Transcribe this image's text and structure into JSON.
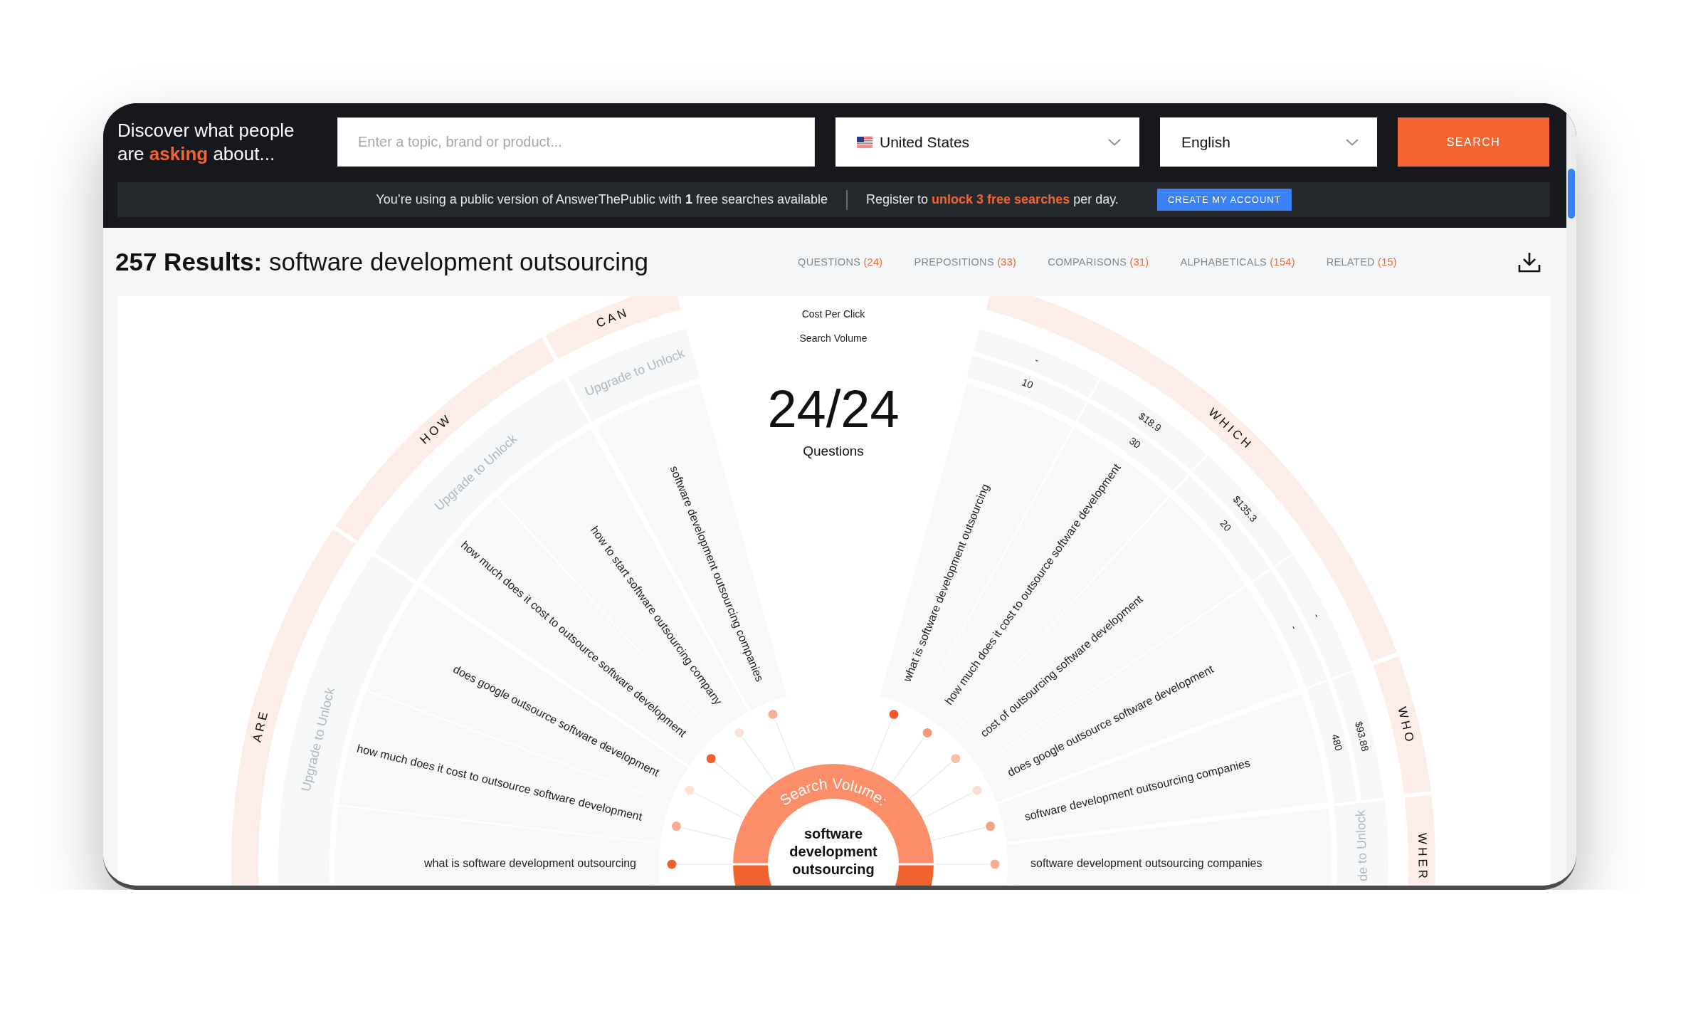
{
  "header": {
    "tagline": "Discover what people are **asking** about...",
    "search_field": {
      "placeholder": "Enter a topic, brand or product..."
    },
    "country": {
      "value": "United States"
    },
    "language": {
      "value": "English"
    },
    "search_button": "SEARCH"
  },
  "notice": {
    "text": "You’re using a public version of AnswerThePublic with **1** free searches available",
    "register_text": "Register to **unlock 3 free searches** per day.",
    "button": "CREATE MY ACCOUNT"
  },
  "results": {
    "title": "**257 Results:** software development outsourcing",
    "tabs": [
      {
        "label": "QUESTIONS",
        "count": "(24)"
      },
      {
        "label": "PREPOSITIONS",
        "count": "(33)"
      },
      {
        "label": "COMPARISONS",
        "count": "(31)"
      },
      {
        "label": "ALPHABETICALS",
        "count": "(154)"
      },
      {
        "label": "RELATED",
        "count": "(15)"
      }
    ]
  },
  "wheel": {
    "legend": [
      "Cost Per Click",
      "Search Volume"
    ],
    "count": "24/24",
    "count_label": "Questions",
    "ring_label": "Search Volume:",
    "center_term": "software development outsourcing",
    "sections": [
      {
        "label": "ARE",
        "locked": true,
        "upgrade_text": "Upgrade to Unlock",
        "questions": [
          {
            "text": "what is software development outsourcing",
            "color": "#f0602f"
          },
          {
            "text": "how much does it cost to outsource software development",
            "color": "#f7ad93"
          },
          {
            "text": "does google outsource software development",
            "color": "#fde2d8"
          }
        ]
      },
      {
        "label": "HOW",
        "locked": true,
        "upgrade_text": "Upgrade to Unlock",
        "questions": [
          {
            "text": "how much does it cost to outsource software development",
            "color": "#f0602f"
          },
          {
            "text": "how to start software outsourcing company",
            "color": "#fde2d8"
          }
        ]
      },
      {
        "label": "CAN",
        "locked": true,
        "upgrade_text": "Upgrade to Unlock",
        "questions": [
          {
            "text": "software development outsourcing companies",
            "color": "#f7ad93"
          }
        ]
      },
      {
        "label": "WHICH",
        "locked": false,
        "questions": [
          {
            "text": "what is software development outsourcing",
            "volume": "10",
            "cpc": "-",
            "color": "#ef5a2c"
          },
          {
            "text": "how much does it cost to outsource software development",
            "volume": "30",
            "cpc": "$18.9",
            "color": "#f59b7a"
          },
          {
            "text": "cost of outsourcing software development",
            "volume": "20",
            "cpc": "$135.3",
            "color": "#f9c0a9"
          },
          {
            "text": "does google outsource software development",
            "volume": "-",
            "cpc": "-",
            "color": "#fde0d5"
          }
        ]
      },
      {
        "label": "WHO",
        "locked": false,
        "questions": [
          {
            "text": "software development outsourcing companies",
            "volume": "480",
            "cpc": "$93.88",
            "color": "#f6a283"
          }
        ]
      },
      {
        "label": "WHER",
        "locked": true,
        "upgrade_text": "de to Unlock",
        "questions": [
          {
            "text": "software development outsourcing companies",
            "color": "#f8ad93"
          }
        ]
      }
    ]
  }
}
